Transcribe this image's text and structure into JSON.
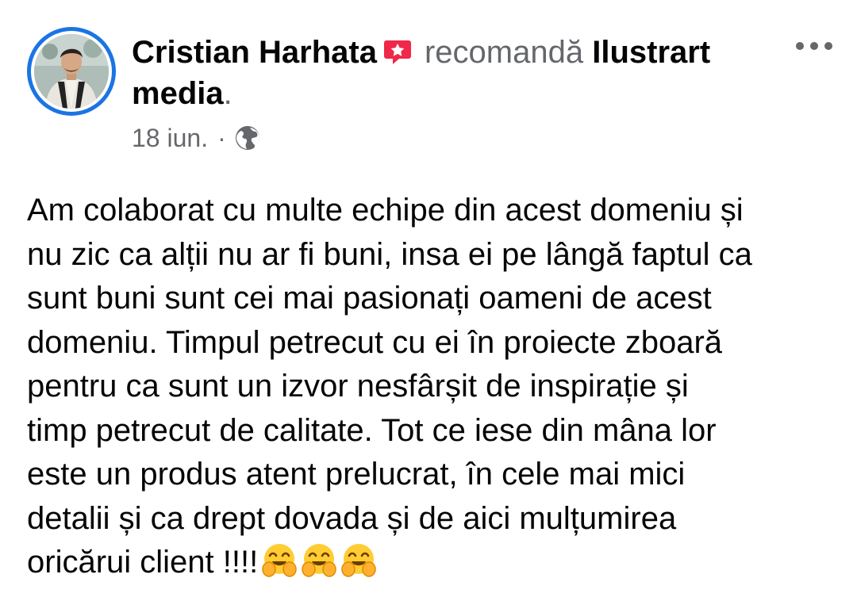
{
  "post": {
    "author": "Cristian Harhata",
    "badge_icon": "recommend-badge-icon",
    "action": "recomandă",
    "page_name_line1": "Ilustrart",
    "page_name_line2": "media",
    "page_name_suffix": ".",
    "date": "18 iun.",
    "separator": "·",
    "privacy_icon": "globe-icon",
    "more_icon": "more-options-icon",
    "body_lines": [
      "Am colaborat cu multe echipe din acest domeniu și",
      "nu zic ca alții nu ar fi buni, insa ei pe lângă faptul ca",
      "sunt buni sunt cei mai pasionați oameni de acest",
      "domeniu. Timpul petrecut cu ei în proiecte zboară",
      "pentru ca sunt un izvor nesfârșit de inspirație și",
      "timp petrecut de calitate. Tot ce iese din mâna lor",
      "este un produs atent prelucrat, în cele mai mici",
      "detalii și ca drept dovada și de aici mulțumirea",
      "oricărui client !!!!"
    ],
    "emojis": [
      "hugging-face",
      "hugging-face",
      "hugging-face"
    ],
    "colors": {
      "avatar_ring": "#1b74e4",
      "badge": "#f02849",
      "secondary_text": "#65676b",
      "primary_text": "#050505"
    }
  }
}
